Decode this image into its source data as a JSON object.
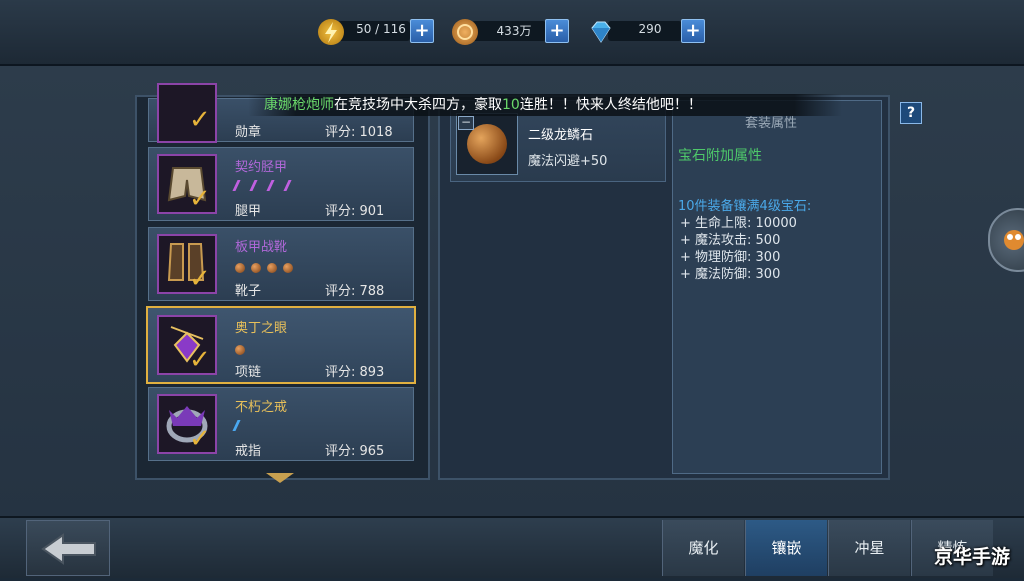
{
  "resources": [
    {
      "name": "stamina",
      "value": "50 / 116",
      "icon": "lightning-icon"
    },
    {
      "name": "gold",
      "value": "433万",
      "icon": "coin-icon"
    },
    {
      "name": "diamond",
      "value": "290",
      "icon": "diamond-icon"
    }
  ],
  "plus_label": "+",
  "broadcast": {
    "player": "康娜枪炮师",
    "text1": "在竞技场中大杀四方，豪取",
    "wins": "10",
    "text2": "连胜！！快来人终结他吧！！"
  },
  "items": [
    {
      "name": "",
      "slot": "勋章",
      "score": "评分: 1018"
    },
    {
      "name": "契约胫甲",
      "slot": "腿甲",
      "score": "评分: 901"
    },
    {
      "name": "板甲战靴",
      "slot": "靴子",
      "score": "评分: 788"
    },
    {
      "name": "奥丁之眼",
      "slot": "项链",
      "score": "评分: 893"
    },
    {
      "name": "不朽之戒",
      "slot": "戒指",
      "score": "评分: 965"
    }
  ],
  "gem": {
    "minus": "−",
    "name": "二级龙鳞石",
    "effect": "魔法闪避+50"
  },
  "set": {
    "title": "套装属性",
    "subtitle": "宝石附加属性",
    "condition": "10件装备镶满4级宝石:",
    "stats": [
      "+ 生命上限:  10000",
      "+ 魔法攻击:  500",
      "+ 物理防御:  300",
      "+ 魔法防御:  300"
    ]
  },
  "help_label": "?",
  "tabs": [
    "魔化",
    "镶嵌",
    "冲星",
    "精炼"
  ],
  "active_tab": "镶嵌",
  "watermark": "京华手游",
  "colors": {
    "accent_gold": "#e0b040",
    "purple_rarity": "#b068d8",
    "set_text": "#4aa8e8",
    "green_text": "#6ad86a"
  }
}
